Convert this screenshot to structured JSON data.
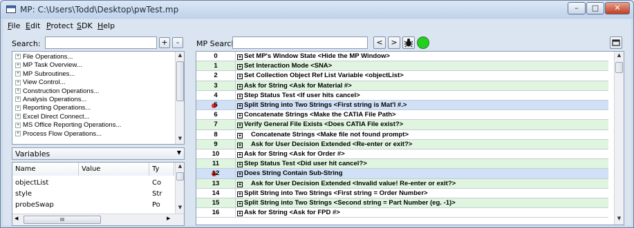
{
  "window": {
    "title": "MP: C:\\Users\\Todd\\Desktop\\pwTest.mp"
  },
  "menu": [
    {
      "label": "File",
      "u": "F",
      "rest": "ile"
    },
    {
      "label": "Edit",
      "u": "E",
      "rest": "dit"
    },
    {
      "label": "Protect",
      "u": "P",
      "rest": "rotect"
    },
    {
      "label": "SDK",
      "u": "S",
      "rest": "DK"
    },
    {
      "label": "Help",
      "u": "H",
      "rest": "elp"
    }
  ],
  "left": {
    "search_label": "Search:",
    "search_value": "",
    "add_label": "+",
    "remove_label": "-",
    "tree": [
      "File Operations...",
      "MP Task Overview...",
      "MP Subroutines...",
      "View Control...",
      "Construction Operations...",
      "Analysis Operations...",
      "Reporting Operations...",
      "Excel Direct Connect...",
      "MS Office Reporting Operations...",
      "Process Flow Operations..."
    ],
    "dropdown_value": "Variables",
    "vars_headers": [
      "Name",
      "Value",
      "Ty"
    ],
    "vars": [
      {
        "name": "objectList",
        "value": "",
        "type": "Co"
      },
      {
        "name": "style",
        "value": "",
        "type": "Str"
      },
      {
        "name": "probeSwap",
        "value": "",
        "type": "Po"
      }
    ],
    "hscroll_glyph": "III"
  },
  "right": {
    "search_label": "MP Search:",
    "search_value": "",
    "prev_label": "<",
    "next_label": ">",
    "bug_icon": "bug-icon",
    "status_color": "#22d11f",
    "rows": [
      {
        "n": "0",
        "text": "Set MP's Window State   <Hide the MP Window>",
        "bg": "#ffffff",
        "bp": false,
        "indent": 0
      },
      {
        "n": "1",
        "text": "Set Interaction Mode   <SNA>",
        "bg": "#dff5df",
        "bp": false,
        "indent": 0
      },
      {
        "n": "2",
        "text": "Set Collection Object Ref List Variable   <objectList>",
        "bg": "#ffffff",
        "bp": false,
        "indent": 0
      },
      {
        "n": "3",
        "text": "Ask for String   <Ask for Material #>",
        "bg": "#dff5df",
        "bp": false,
        "indent": 0
      },
      {
        "n": "4",
        "text": "Step Status Test   <If user hits cancel>",
        "bg": "#ffffff",
        "bp": false,
        "indent": 0
      },
      {
        "n": "5",
        "text": "Split String into Two Strings   <First string is Mat'l #.>",
        "bg": "#cfe0f7",
        "bp": true,
        "indent": 0
      },
      {
        "n": "6",
        "text": "Concatenate Strings   <Make the CATIA File Path>",
        "bg": "#ffffff",
        "bp": false,
        "indent": 0
      },
      {
        "n": "7",
        "text": "Verify General File Exists   <Does CATIA File exist?>",
        "bg": "#dff5df",
        "bp": false,
        "indent": 0
      },
      {
        "n": "8",
        "text": "Concatenate Strings   <Make file not found prompt>",
        "bg": "#ffffff",
        "bp": false,
        "indent": 1
      },
      {
        "n": "9",
        "text": "Ask for User Decision Extended   <Re-enter or exit?>",
        "bg": "#dff5df",
        "bp": false,
        "indent": 1
      },
      {
        "n": "10",
        "text": "Ask for String   <Ask for Order #>",
        "bg": "#ffffff",
        "bp": false,
        "indent": 0
      },
      {
        "n": "11",
        "text": "Step Status Test   <Did user hit cancel?>",
        "bg": "#dff5df",
        "bp": false,
        "indent": 0
      },
      {
        "n": "12",
        "text": "Does String Contain Sub-String",
        "bg": "#cfe0f7",
        "bp": true,
        "indent": 0
      },
      {
        "n": "13",
        "text": "Ask for User Decision Extended   <Invalid value! Re-enter or exit?>",
        "bg": "#dff5df",
        "bp": false,
        "indent": 1
      },
      {
        "n": "14",
        "text": "Split String into Two Strings   <First string = Order Number>",
        "bg": "#ffffff",
        "bp": false,
        "indent": 0
      },
      {
        "n": "15",
        "text": "Split String into Two Strings   <Second string = Part Number (eg. -1)>",
        "bg": "#dff5df",
        "bp": false,
        "indent": 0
      },
      {
        "n": "16",
        "text": "Ask for String   <Ask for FPD #>",
        "bg": "#ffffff",
        "bp": false,
        "indent": 0
      }
    ]
  }
}
